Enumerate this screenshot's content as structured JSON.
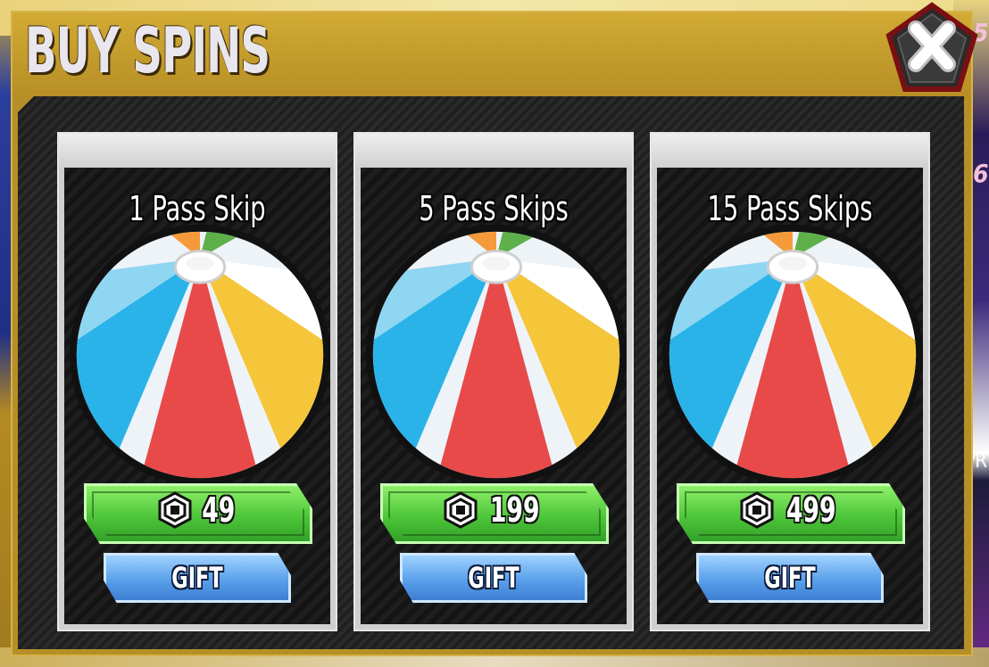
{
  "dialog": {
    "title": "BUY SPINS"
  },
  "background": {
    "right_numbers": [
      "5",
      "6"
    ],
    "right_text": "PR"
  },
  "cards": [
    {
      "name": "1 Pass Skip",
      "price": "49",
      "gift_label": "GIFT",
      "currency_icon": "robux-icon"
    },
    {
      "name": "5 Pass Skips",
      "price": "199",
      "gift_label": "GIFT",
      "currency_icon": "robux-icon"
    },
    {
      "name": "15 Pass Skips",
      "price": "499",
      "gift_label": "GIFT",
      "currency_icon": "robux-icon"
    }
  ],
  "colors": {
    "frame_gold": "#b58f27",
    "buy_green": "#4ec63a",
    "gift_blue": "#5aa0ea",
    "ball_red": "#e84a4a",
    "ball_blue": "#2ab3e8",
    "ball_yellow": "#f5c53a",
    "ball_green": "#5db04a",
    "ball_orange": "#f59a3a"
  }
}
